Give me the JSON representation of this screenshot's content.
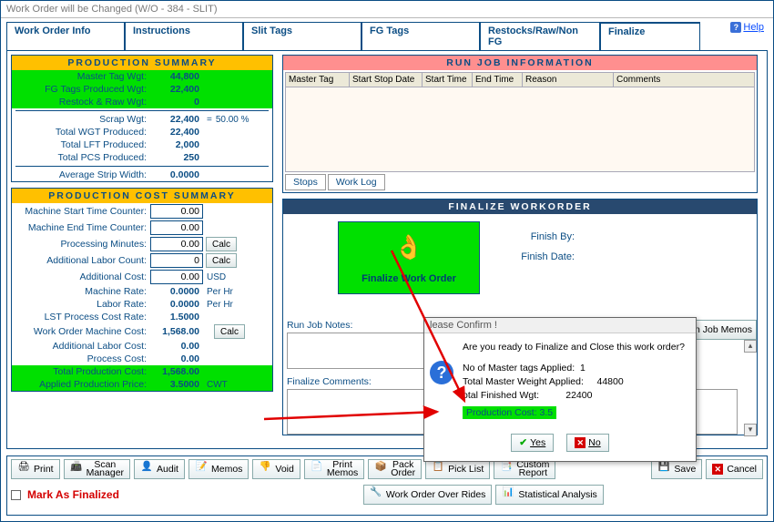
{
  "window_title": "Work Order will be Changed  (W/O - 384 - SLIT)",
  "tabs": {
    "t0": "Work Order Info",
    "t1": "Instructions",
    "t2": "Slit Tags",
    "t3": "FG Tags",
    "t4": "Restocks/Raw/Non FG",
    "t5": "Finalize"
  },
  "help": "Help",
  "prod_summary": {
    "header": "PRODUCTION   SUMMARY",
    "rows": {
      "master_tag_wgt": {
        "lbl": "Master Tag Wgt:",
        "val": "44,800"
      },
      "fg_tags_produced": {
        "lbl": "FG Tags Produced Wgt:",
        "val": "22,400"
      },
      "restock_raw": {
        "lbl": "Restock & Raw Wgt:",
        "val": "0"
      },
      "scrap": {
        "lbl": "Scrap Wgt:",
        "val": "22,400",
        "eq": "=",
        "pct": "50.00  %"
      },
      "total_wgt": {
        "lbl": "Total WGT Produced:",
        "val": "22,400"
      },
      "total_lft": {
        "lbl": "Total LFT Produced:",
        "val": "2,000"
      },
      "total_pcs": {
        "lbl": "Total PCS Produced:",
        "val": "250"
      },
      "avg_strip": {
        "lbl": "Average Strip Width:",
        "val": "0.0000"
      }
    }
  },
  "cost_summary": {
    "header": "PRODUCTION  COST SUMMARY",
    "machine_start": {
      "lbl": "Machine Start Time Counter:",
      "val": "0.00"
    },
    "machine_end": {
      "lbl": "Machine End Time Counter:",
      "val": "0.00"
    },
    "processing_min": {
      "lbl": "Processing Minutes:",
      "val": "0.00"
    },
    "add_labor_cnt": {
      "lbl": "Additional Labor Count:",
      "val": "0"
    },
    "add_cost": {
      "lbl": "Additional Cost:",
      "val": "0.00",
      "unit": "USD"
    },
    "machine_rate": {
      "lbl": "Machine Rate:",
      "val": "0.0000",
      "unit": "Per Hr"
    },
    "labor_rate": {
      "lbl": "Labor Rate:",
      "val": "0.0000",
      "unit": "Per Hr"
    },
    "lst_rate": {
      "lbl": "LST Process Cost Rate:",
      "val": "1.5000"
    },
    "wom_cost": {
      "lbl": "Work Order Machine Cost:",
      "val": "1,568.00"
    },
    "add_labor_cost": {
      "lbl": "Additional Labor Cost:",
      "val": "0.00"
    },
    "process_cost": {
      "lbl": "Process Cost:",
      "val": "0.00"
    },
    "total_prod_cost": {
      "lbl": "Total Production Cost:",
      "val": "1,568.00"
    },
    "applied_price": {
      "lbl": "Applied Production Price:",
      "val": "3.5000",
      "unit": "CWT"
    },
    "calc": "Calc"
  },
  "run_job": {
    "header": "RUN  JOB  INFORMATION",
    "cols": {
      "c0": "Master Tag",
      "c1": "Start Stop Date",
      "c2": "Start Time",
      "c3": "End Time",
      "c4": "Reason",
      "c5": "Comments"
    },
    "subtabs": {
      "stops": "Stops",
      "worklog": "Work Log"
    }
  },
  "finalize": {
    "header": "FINALIZE   WORKORDER",
    "btn": "Finalize Work Order",
    "finish_by": "Finish By:",
    "finish_date": "Finish Date:",
    "run_notes": "Run Job Notes:",
    "final_comments": "Finalize Comments:",
    "job_memos_btn": "n Job Memos"
  },
  "dialog": {
    "title": "lease Confirm !",
    "q": "Are you ready to Finalize and Close this work order?",
    "l1a": "No of Master tags Applied:",
    "l1b": "1",
    "l2a": "Total Master Weight Applied:",
    "l2b": "44800",
    "l3a": "otal Finished Wgt:",
    "l3b": "22400",
    "prod_cost": "Production Cost:  3.5",
    "yes": "Yes",
    "no": "No"
  },
  "toolbar": {
    "print": "Print",
    "scan": "Scan\nManager",
    "audit": "Audit",
    "memos": "Memos",
    "void": "Void",
    "print_memos": "Print\nMemos",
    "pack": "Pack\nOrder",
    "pick": "Pick List",
    "custom": "Custom\nReport",
    "save": "Save",
    "cancel": "Cancel",
    "mark": "Mark As Finalized",
    "overrides": "Work Order Over Rides",
    "stats": "Statistical Analysis"
  }
}
